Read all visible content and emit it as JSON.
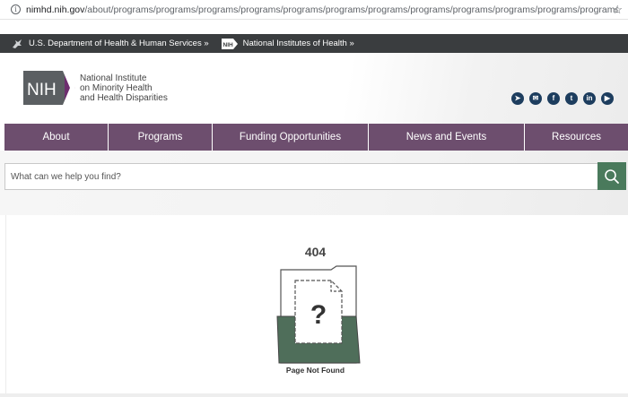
{
  "browser": {
    "url_domain": "nimhd.nih.gov",
    "url_path": "/about/programs/programs/programs/programs/programs/programs/programs/programs/programs/programs/programs/programs/programs/programs/p...",
    "icons": [
      "info-icon",
      "star-icon"
    ]
  },
  "topbar": {
    "hhs_link": "U.S. Department of Health & Human Services »",
    "nih_badge": "NIH",
    "nih_link": "National Institutes of Health »"
  },
  "header": {
    "logo_text": "NIH",
    "org_name": [
      "National Institute",
      "on Minority Health",
      "and Health Disparities"
    ],
    "social_icons": [
      "telegram-icon",
      "email-icon",
      "facebook-icon",
      "twitter-icon",
      "linkedin-icon",
      "youtube-icon"
    ]
  },
  "nav": {
    "items": [
      "About",
      "Programs",
      "Funding Opportunities",
      "News and Events",
      "Resources"
    ]
  },
  "search": {
    "placeholder": "What can we help you find?"
  },
  "error": {
    "code": "404",
    "symbol": "?",
    "message": "Page Not Found"
  },
  "colors": {
    "nav_bg": "#6d4e6e",
    "topbar_bg": "#3a3d3f",
    "accent_green": "#4a7a5c",
    "social_bg": "#1d3d5e"
  }
}
